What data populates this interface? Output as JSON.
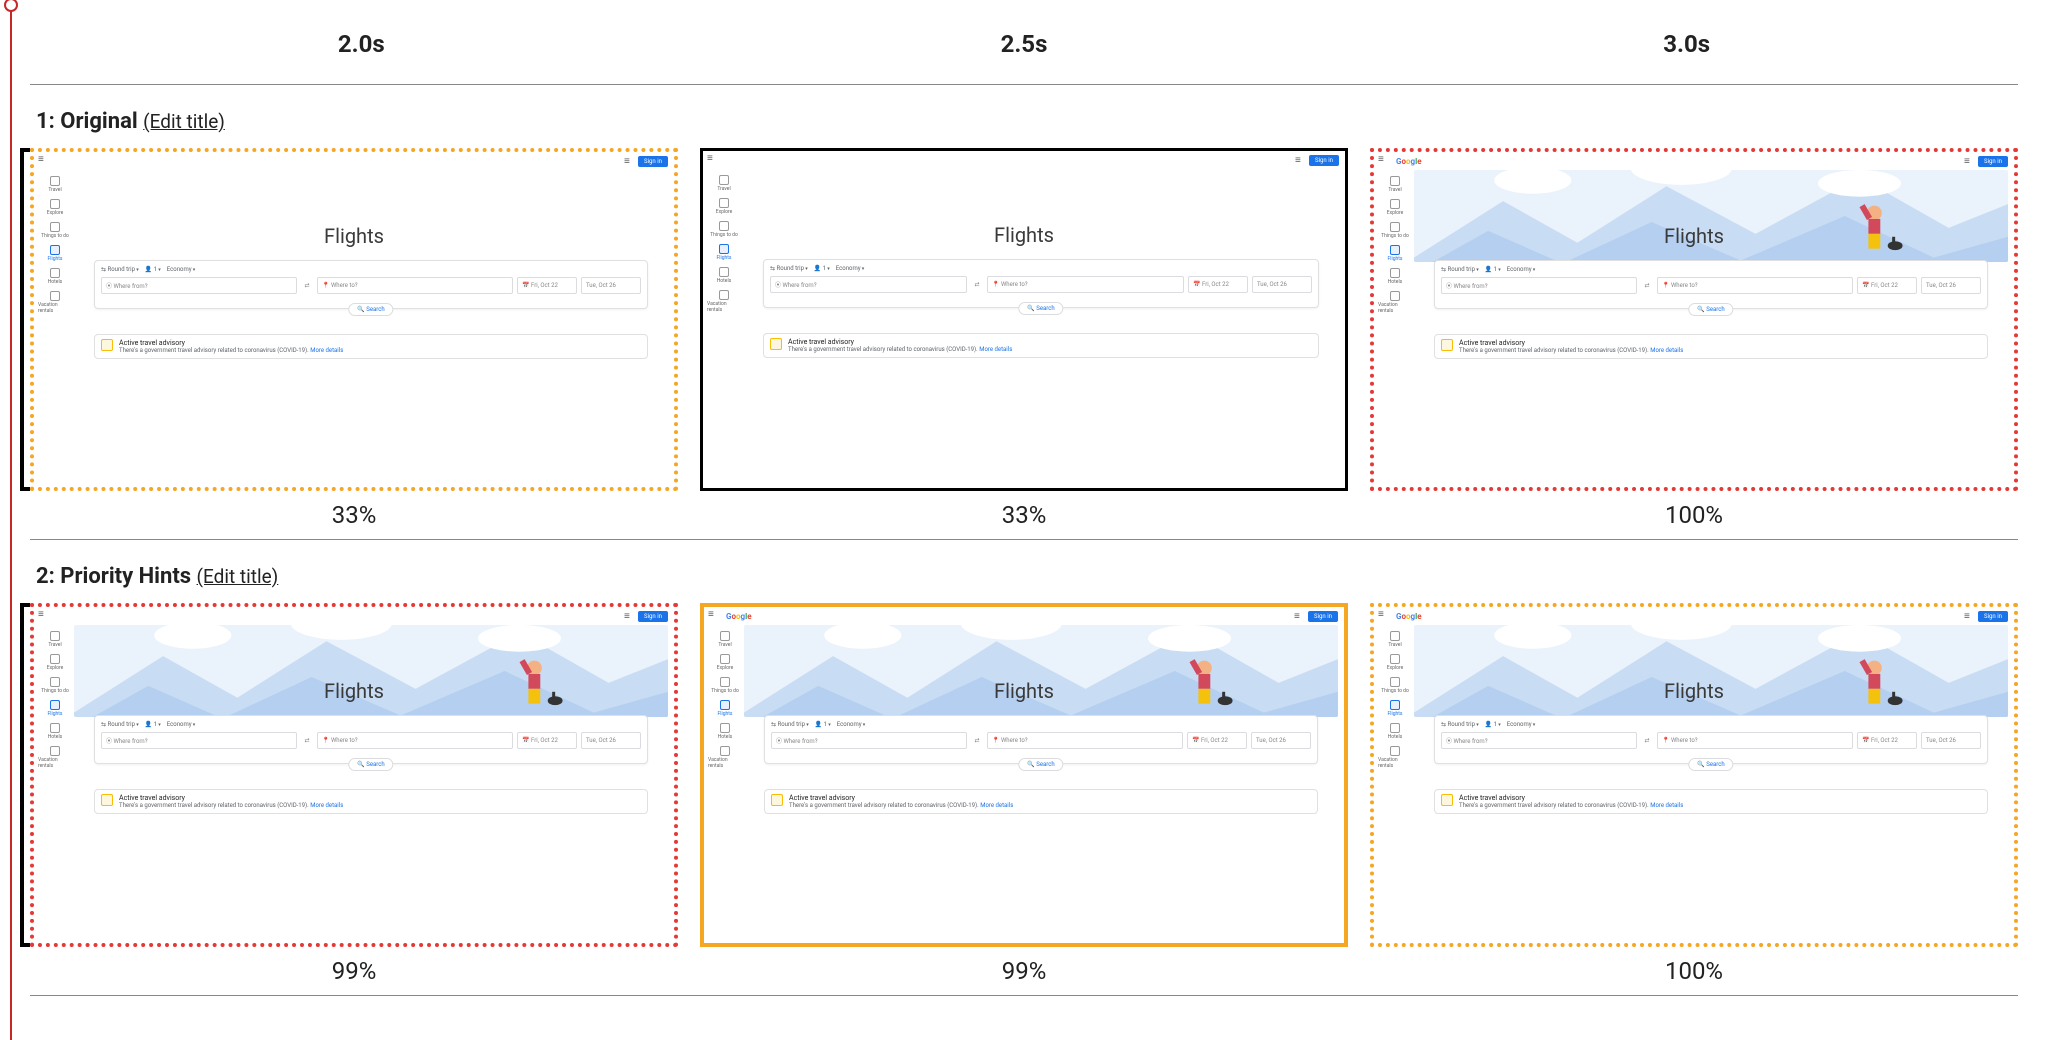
{
  "timeline": {
    "times": [
      "2.0s",
      "2.5s",
      "3.0s"
    ]
  },
  "rows": [
    {
      "index": "1",
      "title": "Original",
      "edit_label": "(Edit title)",
      "frames": [
        {
          "border": "dotted-orange",
          "bracket": true,
          "hero": false,
          "google_logo": false,
          "pct": "33%"
        },
        {
          "border": "solid-black",
          "bracket": false,
          "hero": false,
          "google_logo": false,
          "pct": "33%"
        },
        {
          "border": "dotted-red",
          "bracket": false,
          "hero": true,
          "google_logo": true,
          "pct": "100%"
        }
      ]
    },
    {
      "index": "2",
      "title": "Priority Hints",
      "edit_label": "(Edit title)",
      "frames": [
        {
          "border": "dotted-red",
          "bracket": true,
          "hero": true,
          "google_logo": false,
          "pct": "99%"
        },
        {
          "border": "solid-orange",
          "bracket": false,
          "hero": true,
          "google_logo": true,
          "pct": "99%"
        },
        {
          "border": "dotted-orange",
          "bracket": false,
          "hero": true,
          "google_logo": true,
          "pct": "100%"
        }
      ]
    }
  ],
  "flights_mock": {
    "sign_in": "Sign in",
    "logo_text": "Google",
    "sidebar": [
      {
        "label": "Travel"
      },
      {
        "label": "Explore"
      },
      {
        "label": "Things to do"
      },
      {
        "label": "Flights",
        "active": true
      },
      {
        "label": "Hotels"
      },
      {
        "label": "Vacation rentals"
      }
    ],
    "title": "Flights",
    "chips": {
      "trip": "Round trip",
      "pax": "1",
      "cabin": "Economy"
    },
    "fields": {
      "from_placeholder": "Where from?",
      "to_placeholder": "Where to?",
      "date_out": "Fri, Oct 22",
      "date_back": "Tue, Oct 26"
    },
    "search_btn": "Search",
    "advisory": {
      "title": "Active travel advisory",
      "desc": "There's a government travel advisory related to coronavirus (COVID-19).",
      "link": "More details"
    }
  }
}
